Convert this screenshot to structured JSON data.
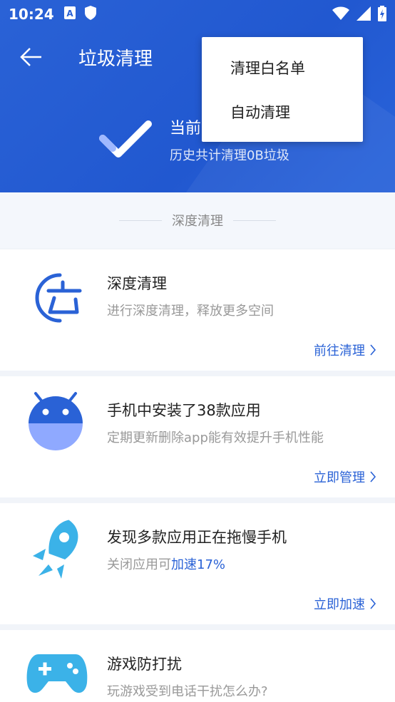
{
  "status_bar": {
    "time": "10:24"
  },
  "header": {
    "title": "垃圾清理",
    "current_text": "当前",
    "history_text": "历史共计清理0B垃圾"
  },
  "section": {
    "label": "深度清理"
  },
  "cards": [
    {
      "title": "深度清理",
      "desc": "进行深度清理，释放更多空间",
      "action": "前往清理"
    },
    {
      "title": "手机中安装了38款应用",
      "desc": "定期更新删除app能有效提升手机性能",
      "action": "立即管理"
    },
    {
      "title": "发现多款应用正在拖慢手机",
      "desc_prefix": "关闭应用可",
      "desc_accent": "加速17%",
      "action": "立即加速"
    },
    {
      "title": "游戏防打扰",
      "desc": "玩游戏受到电话干扰怎么办?"
    }
  ],
  "popup_menu": {
    "items": [
      "清理白名单",
      "自动清理"
    ]
  },
  "colors": {
    "primary": "#2a62d6",
    "accent_light": "#8fa9ff",
    "rocket": "#3bb2e8"
  }
}
